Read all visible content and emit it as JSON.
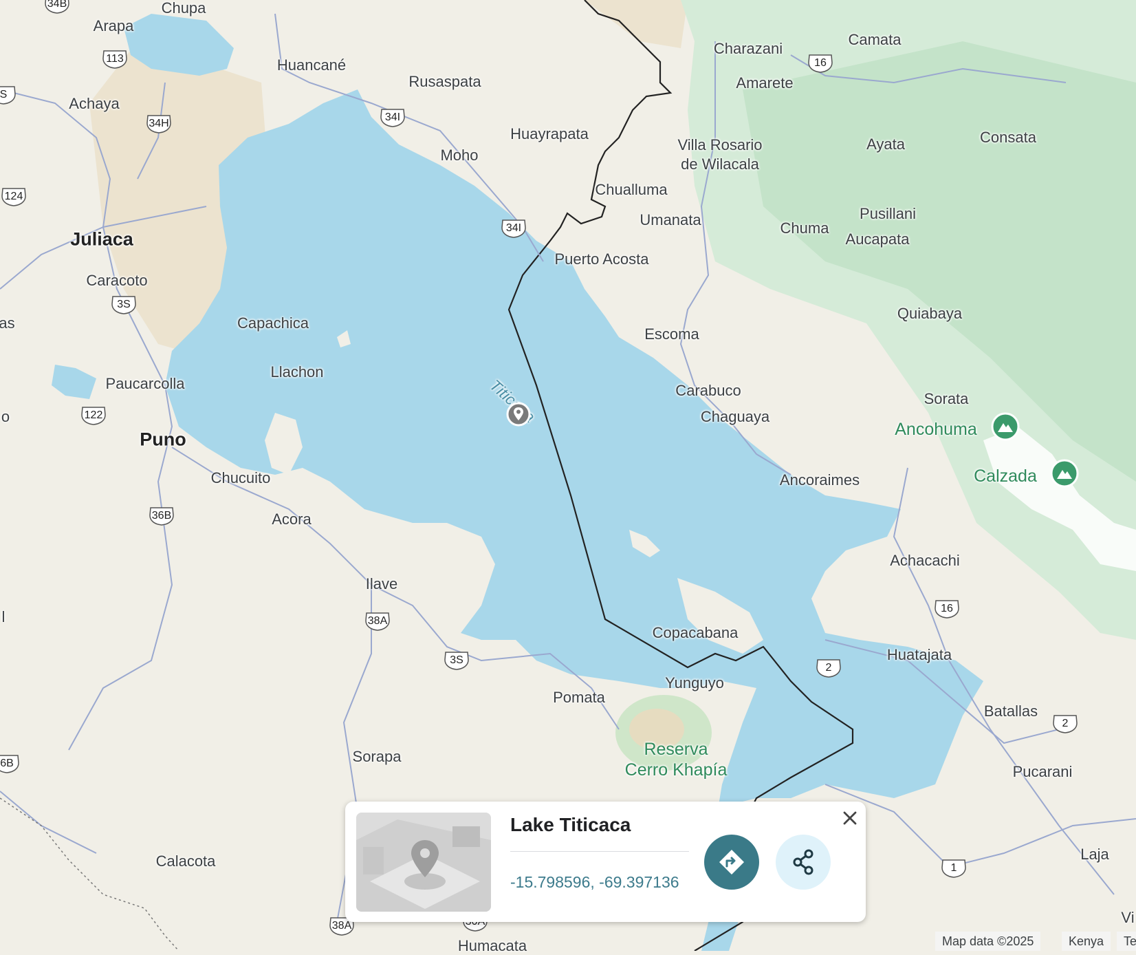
{
  "map": {
    "lake_label": "Titicaca",
    "places": [
      {
        "name": "Chupa",
        "kind": "town"
      },
      {
        "name": "Arapa",
        "kind": "town"
      },
      {
        "name": "Huancané",
        "kind": "town"
      },
      {
        "name": "Achaya",
        "kind": "town"
      },
      {
        "name": "Rusaspata",
        "kind": "town"
      },
      {
        "name": "Huayrapata",
        "kind": "town"
      },
      {
        "name": "Moho",
        "kind": "town"
      },
      {
        "name": "Charazani",
        "kind": "town"
      },
      {
        "name": "Camata",
        "kind": "town"
      },
      {
        "name": "Amarete",
        "kind": "town"
      },
      {
        "name": "Villa Rosario\nde Wilacala",
        "kind": "town"
      },
      {
        "name": "Ayata",
        "kind": "town"
      },
      {
        "name": "Consata",
        "kind": "town"
      },
      {
        "name": "Juliaca",
        "kind": "city"
      },
      {
        "name": "Chualluma",
        "kind": "town"
      },
      {
        "name": "Umanata",
        "kind": "town"
      },
      {
        "name": "Chuma",
        "kind": "town"
      },
      {
        "name": "Pusillani",
        "kind": "town"
      },
      {
        "name": "Aucapata",
        "kind": "town"
      },
      {
        "name": "Puerto Acosta",
        "kind": "town"
      },
      {
        "name": "Caracoto",
        "kind": "town"
      },
      {
        "name": "Capachica",
        "kind": "town"
      },
      {
        "name": "Quiabaya",
        "kind": "town"
      },
      {
        "name": "Escoma",
        "kind": "town"
      },
      {
        "name": "Llachon",
        "kind": "town"
      },
      {
        "name": "Paucarcolla",
        "kind": "town"
      },
      {
        "name": "Carabuco",
        "kind": "town"
      },
      {
        "name": "Sorata",
        "kind": "town"
      },
      {
        "name": "Chaguaya",
        "kind": "town"
      },
      {
        "name": "Ancohuma",
        "kind": "peak"
      },
      {
        "name": "Puno",
        "kind": "city"
      },
      {
        "name": "Calzada",
        "kind": "peak"
      },
      {
        "name": "Chucuito",
        "kind": "town"
      },
      {
        "name": "Ancoraimes",
        "kind": "town"
      },
      {
        "name": "Acora",
        "kind": "town"
      },
      {
        "name": "Achacachi",
        "kind": "town"
      },
      {
        "name": "Ilave",
        "kind": "town"
      },
      {
        "name": "Copacabana",
        "kind": "town"
      },
      {
        "name": "Huatajata",
        "kind": "town"
      },
      {
        "name": "Yunguyo",
        "kind": "town"
      },
      {
        "name": "Pomata",
        "kind": "town"
      },
      {
        "name": "Batallas",
        "kind": "town"
      },
      {
        "name": "Reserva\nCerro Khapía",
        "kind": "park"
      },
      {
        "name": "Sorapa",
        "kind": "town"
      },
      {
        "name": "Pucarani",
        "kind": "town"
      },
      {
        "name": "Calacota",
        "kind": "town"
      },
      {
        "name": "Laja",
        "kind": "town"
      },
      {
        "name": "Humacata",
        "kind": "town"
      },
      {
        "name": "as",
        "kind": "town"
      },
      {
        "name": "o",
        "kind": "town"
      },
      {
        "name": "l",
        "kind": "town"
      },
      {
        "name": "Vi",
        "kind": "town"
      }
    ],
    "road_shields": [
      "34B",
      "113",
      "34H",
      "124",
      "3S",
      "122",
      "36B",
      "38A",
      "3S",
      "34I",
      "34I",
      "16",
      "16",
      "2",
      "2",
      "1",
      "38A",
      "30A",
      "6B",
      "S"
    ]
  },
  "place_card": {
    "title": "Lake Titicaca",
    "coordinates": "-15.798596, -69.397136",
    "directions_icon": "directions-icon",
    "share_icon": "share-icon",
    "close_icon": "close-icon"
  },
  "attribution": {
    "map_data": "Map data ©2025",
    "country": "Kenya",
    "terms": "Te"
  },
  "colors": {
    "water": "#a8d7ea",
    "land": "#f1efe7",
    "forest": "#d5ebd8",
    "accent": "#3a7a88",
    "park_text": "#2f8a5b"
  }
}
